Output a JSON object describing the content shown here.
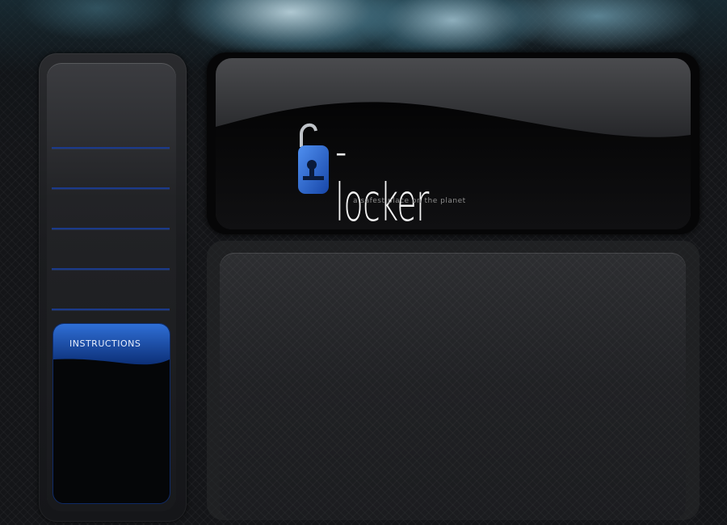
{
  "logo": {
    "icon": "padlock-icon",
    "wordmark": "-locker",
    "tagline": "a safest place on the planet"
  },
  "sidebar": {
    "items": [
      {
        "label": ""
      },
      {
        "label": ""
      },
      {
        "label": ""
      },
      {
        "label": ""
      },
      {
        "label": ""
      }
    ],
    "instructions": {
      "title": "INSTRUCTIONS"
    }
  },
  "colors": {
    "accent": "#1f5fd8",
    "nav_divider": "#1b3a8a",
    "background": "#141518"
  }
}
